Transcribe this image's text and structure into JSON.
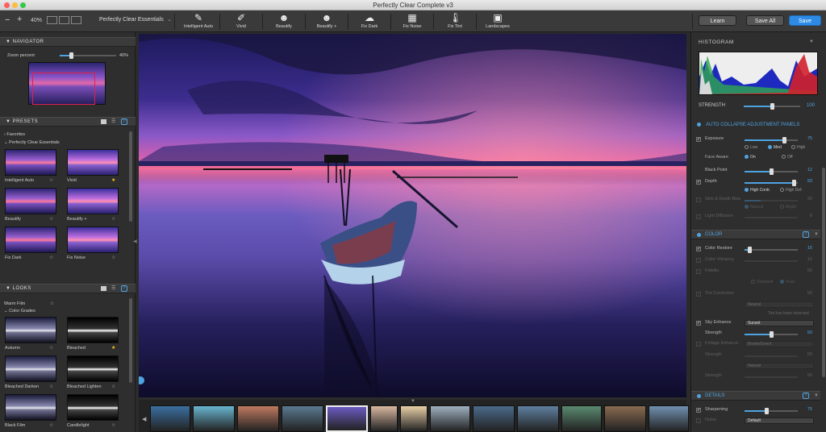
{
  "window": {
    "title": "Perfectly Clear Complete v3"
  },
  "toolbar": {
    "zoom": "40%",
    "preset_select": "Perfectly Clear Essentials",
    "tools": [
      {
        "label": "Intelligent Auto",
        "icon": "wand-icon"
      },
      {
        "label": "Vivid",
        "icon": "brush-icon"
      },
      {
        "label": "Beautify",
        "icon": "face-icon"
      },
      {
        "label": "Beautify +",
        "icon": "face-plus-icon"
      },
      {
        "label": "Fix Dark",
        "icon": "cloud-icon"
      },
      {
        "label": "Fix Noise",
        "icon": "noise-icon"
      },
      {
        "label": "Fix Tint",
        "icon": "thermometer-icon"
      },
      {
        "label": "Landscapes",
        "icon": "landscape-icon"
      }
    ],
    "learn": "Learn",
    "save_all": "Save All",
    "save": "Save"
  },
  "navigator": {
    "title": "NAVIGATOR",
    "zoom_label": "Zoom percent",
    "zoom_value": "40%",
    "zoom_fraction": 0.2
  },
  "presets": {
    "title": "PRESETS",
    "group1": "Favorites",
    "group2": "Perfectly Clear Essentials",
    "items": [
      {
        "label": "Intelligent Auto",
        "fav": false
      },
      {
        "label": "Vivid",
        "fav": true
      },
      {
        "label": "Beautify",
        "fav": false
      },
      {
        "label": "Beautify +",
        "fav": false
      },
      {
        "label": "Fix Dark",
        "fav": false
      },
      {
        "label": "Fix Noise",
        "fav": false
      }
    ]
  },
  "looks": {
    "title": "LOOKS",
    "item_top": "Warm Film",
    "group": "Color Grades",
    "items": [
      {
        "label": "Autumn",
        "fav": false
      },
      {
        "label": "Bleached",
        "fav": true
      },
      {
        "label": "Bleached Darken",
        "fav": false
      },
      {
        "label": "Bleached Lighten",
        "fav": false
      },
      {
        "label": "Black Film",
        "fav": false
      },
      {
        "label": "Candlelight",
        "fav": false
      }
    ]
  },
  "histogram": {
    "title": "HISTOGRAM",
    "strength_label": "STRENGTH",
    "strength": "100"
  },
  "adjust": {
    "auto_collapse": "AUTO COLLAPSE ADJUSTMENT PANELS",
    "exposure": {
      "label": "Exposure",
      "value": "75",
      "frac": 0.75
    },
    "exposure_opts": [
      "Low",
      "Med",
      "High"
    ],
    "face_aware": "Face Aware",
    "face_opts": [
      "On",
      "Off"
    ],
    "black_point": {
      "label": "Black Point",
      "value": "12",
      "frac": 0.5
    },
    "depth": {
      "label": "Depth",
      "value": "93",
      "frac": 0.93
    },
    "depth_opts": [
      "High Contr.",
      "High Def."
    ],
    "skin": {
      "label": "Skin & Depth Bias",
      "value": "30"
    },
    "skin_opts": [
      "Natural",
      "Bright"
    ],
    "light": {
      "label": "Light Diffusion",
      "value": "0"
    },
    "color_title": "COLOR",
    "color_restore": {
      "label": "Color Restore",
      "value": "15",
      "frac": 0.15
    },
    "color_vibrancy": {
      "label": "Color Vibrancy",
      "value": "10"
    },
    "fidelity": {
      "label": "Fidelity",
      "value": "50"
    },
    "fidelity_opts": [
      "Standard",
      "Vivid"
    ],
    "tint": {
      "label": "Tint Correction",
      "value": "50",
      "select": "Neutral",
      "note": "Tint has been detected"
    },
    "sky": {
      "label": "Sky Enhance",
      "select": "Sunset",
      "strength_label": "Strength",
      "value": "50",
      "frac": 0.5
    },
    "foliage": {
      "label": "Foliage Enhance",
      "select": "Brown/Green",
      "strength_label": "Strength",
      "value": "50",
      "select2": "Natural"
    },
    "strength3": {
      "label": "Strength",
      "value": "50"
    },
    "details_title": "DETAILS",
    "sharpening": {
      "label": "Sharpening",
      "value": "75",
      "frac": 0.4
    },
    "noise": {
      "label": "Noise",
      "select": "Default"
    }
  }
}
